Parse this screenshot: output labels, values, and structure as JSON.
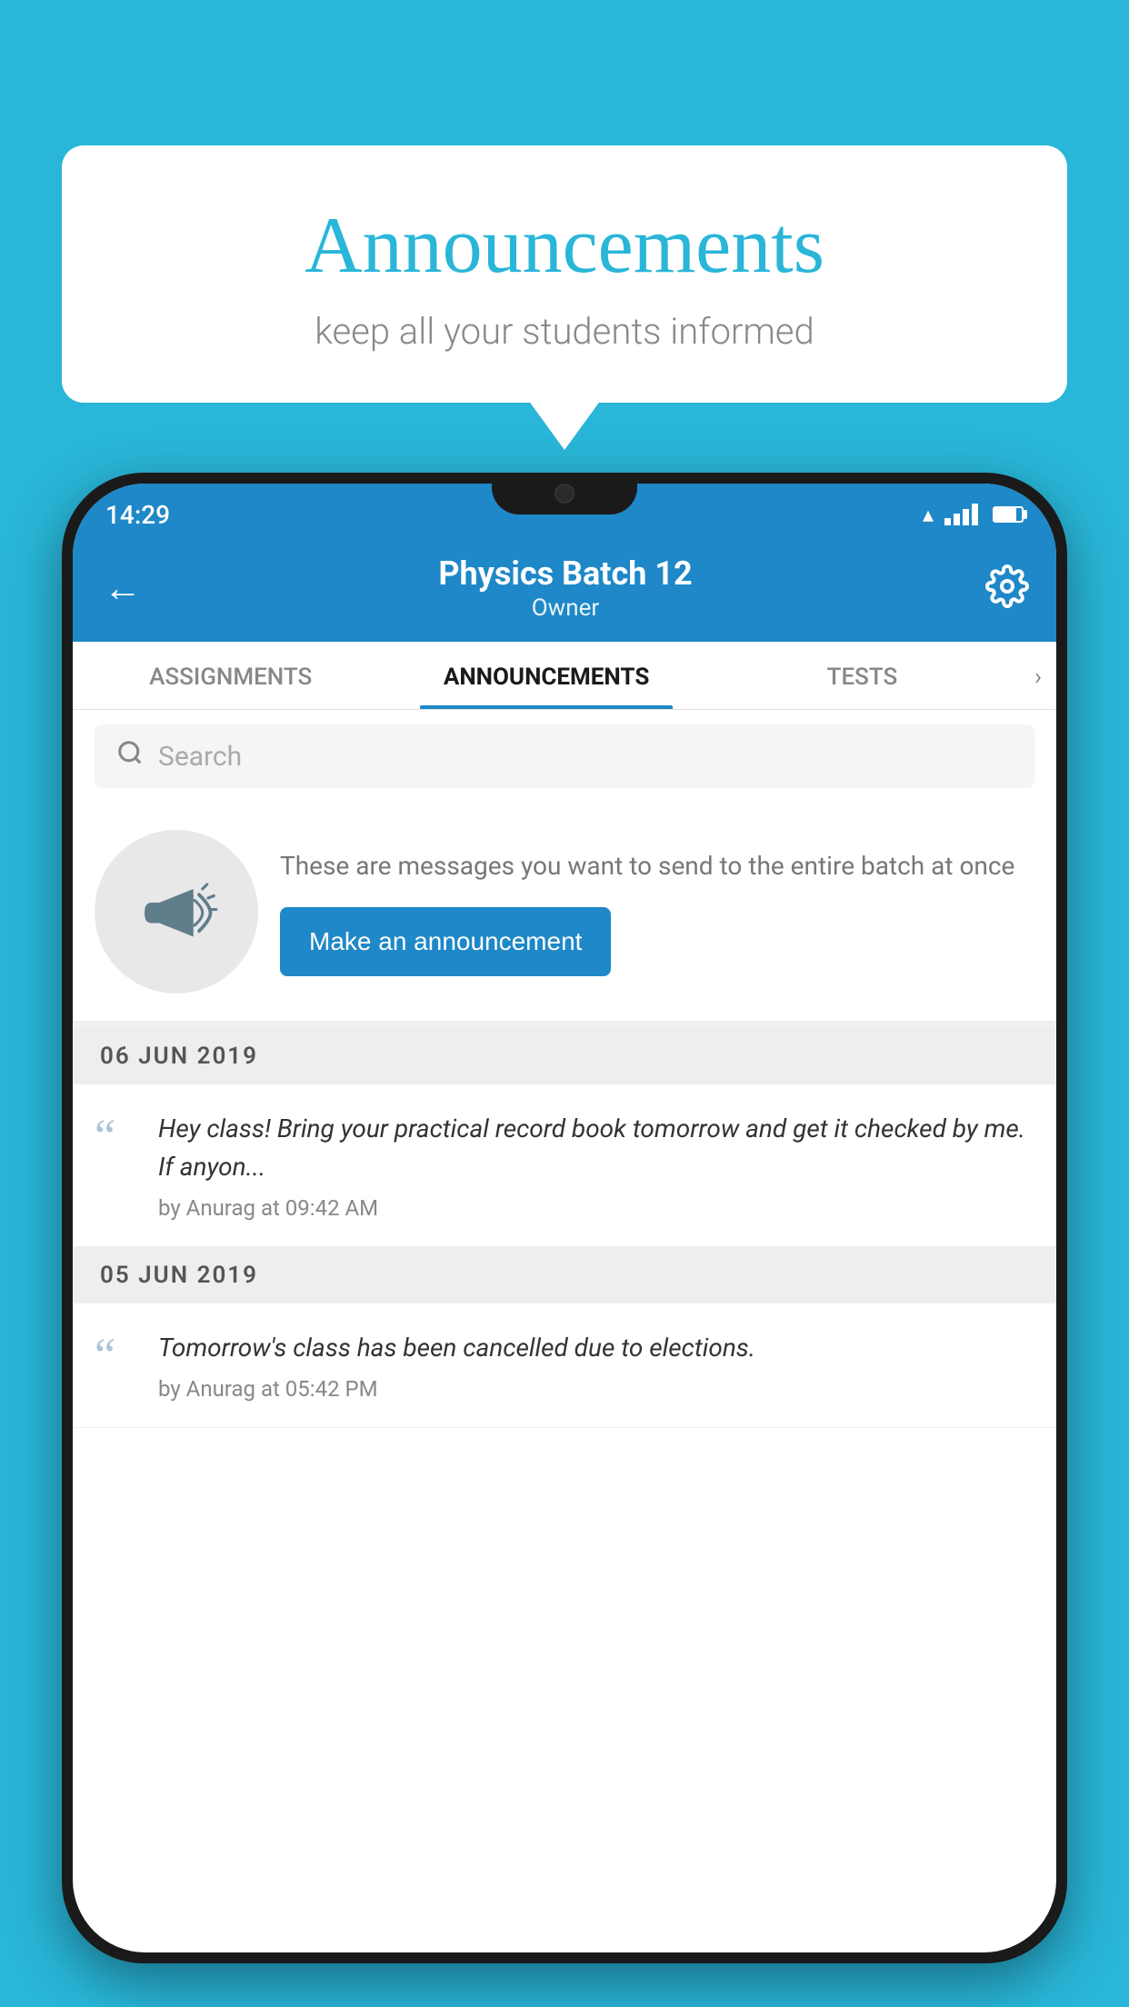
{
  "background_color": "#29b6d8",
  "bubble": {
    "title": "Announcements",
    "subtitle": "keep all your students informed"
  },
  "status_bar": {
    "time": "14:29"
  },
  "header": {
    "title": "Physics Batch 12",
    "subtitle": "Owner",
    "back_label": "←"
  },
  "tabs": [
    {
      "label": "ASSIGNMENTS",
      "active": false
    },
    {
      "label": "ANNOUNCEMENTS",
      "active": true
    },
    {
      "label": "TESTS",
      "active": false
    }
  ],
  "search": {
    "placeholder": "Search"
  },
  "promo": {
    "description": "These are messages you want to send to the entire batch at once",
    "button_label": "Make an announcement"
  },
  "date_groups": [
    {
      "date": "06  JUN  2019",
      "announcements": [
        {
          "text": "Hey class! Bring your practical record book tomorrow and get it checked by me. If anyon...",
          "meta": "by Anurag at 09:42 AM"
        }
      ]
    },
    {
      "date": "05  JUN  2019",
      "announcements": [
        {
          "text": "Tomorrow's class has been cancelled due to elections.",
          "meta": "by Anurag at 05:42 PM"
        }
      ]
    }
  ]
}
